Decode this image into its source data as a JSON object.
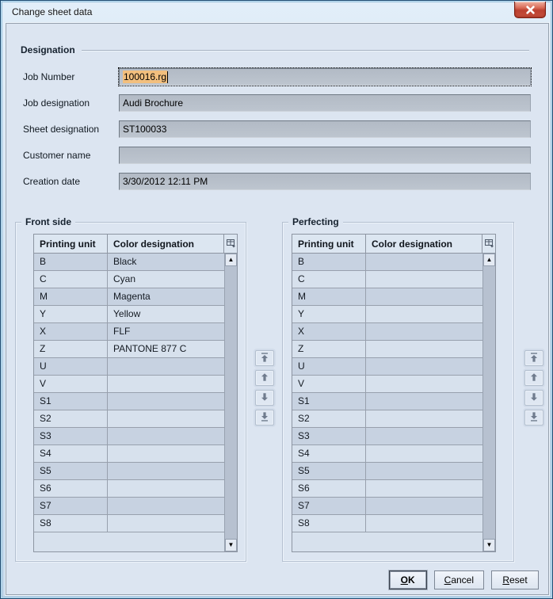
{
  "window": {
    "title": "Change sheet data"
  },
  "icons": {
    "close": "close-icon",
    "column_chooser": "table-columns-icon",
    "scroll_up": "triangle-up-icon",
    "scroll_down": "triangle-down-icon"
  },
  "designation": {
    "section_title": "Designation",
    "fields": [
      {
        "name": "job-number",
        "label": "Job Number",
        "value": "100016.rg",
        "focused": true
      },
      {
        "name": "job-designation",
        "label": "Job designation",
        "value": "Audi Brochure",
        "focused": false
      },
      {
        "name": "sheet-designation",
        "label": "Sheet designation",
        "value": "ST100033",
        "focused": false
      },
      {
        "name": "customer-name",
        "label": "Customer name",
        "value": "",
        "focused": false
      },
      {
        "name": "creation-date",
        "label": "Creation date",
        "value": "3/30/2012 12:11 PM",
        "focused": false
      }
    ]
  },
  "scrollbar": {
    "up_glyph": "▲",
    "down_glyph": "▼"
  },
  "tables": [
    {
      "name": "front-side",
      "title": "Front side",
      "columns": [
        "Printing unit",
        "Color designation"
      ],
      "rows": [
        [
          "B",
          "Black"
        ],
        [
          "C",
          "Cyan"
        ],
        [
          "M",
          "Magenta"
        ],
        [
          "Y",
          "Yellow"
        ],
        [
          "X",
          "FLF"
        ],
        [
          "Z",
          "PANTONE 877 C"
        ],
        [
          "U",
          ""
        ],
        [
          "V",
          ""
        ],
        [
          "S1",
          ""
        ],
        [
          "S2",
          ""
        ],
        [
          "S3",
          ""
        ],
        [
          "S4",
          ""
        ],
        [
          "S5",
          ""
        ],
        [
          "S6",
          ""
        ],
        [
          "S7",
          ""
        ],
        [
          "S8",
          ""
        ]
      ]
    },
    {
      "name": "perfecting",
      "title": "Perfecting",
      "columns": [
        "Printing unit",
        "Color designation"
      ],
      "rows": [
        [
          "B",
          ""
        ],
        [
          "C",
          ""
        ],
        [
          "M",
          ""
        ],
        [
          "Y",
          ""
        ],
        [
          "X",
          ""
        ],
        [
          "Z",
          ""
        ],
        [
          "U",
          ""
        ],
        [
          "V",
          ""
        ],
        [
          "S1",
          ""
        ],
        [
          "S2",
          ""
        ],
        [
          "S3",
          ""
        ],
        [
          "S4",
          ""
        ],
        [
          "S5",
          ""
        ],
        [
          "S6",
          ""
        ],
        [
          "S7",
          ""
        ],
        [
          "S8",
          ""
        ]
      ]
    }
  ],
  "move_buttons": [
    {
      "name": "move-to-top-button",
      "icon": "arrow-to-top-icon"
    },
    {
      "name": "move-up-button",
      "icon": "arrow-up-icon"
    },
    {
      "name": "move-down-button",
      "icon": "arrow-down-icon"
    },
    {
      "name": "move-to-bottom-button",
      "icon": "arrow-to-bottom-icon"
    }
  ],
  "buttons": [
    {
      "name": "ok-button",
      "label": "OK",
      "default": true
    },
    {
      "name": "cancel-button",
      "label": "Cancel",
      "default": false
    },
    {
      "name": "reset-button",
      "label": "Reset",
      "default": false
    }
  ],
  "colors": {
    "selection_highlight": "#f2bf7e",
    "row_odd": "#c7d2e1",
    "row_even": "#d7e1ed",
    "panel_background": "#dce5f1",
    "input_background": "#b8c0ca",
    "close_button_red": "#c6503c",
    "grid_line": "#98a0ad"
  }
}
